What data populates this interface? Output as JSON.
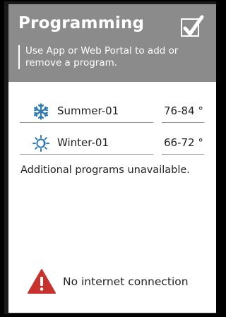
{
  "header": {
    "title": "Programming",
    "subtitle": "Use App or Web Portal to add or remove a program.",
    "checkbox_icon": "checkmark-icon",
    "background": "#8b8b8b"
  },
  "programs": [
    {
      "icon": "snowflake-icon",
      "name": "Summer-01",
      "temp": "76-84 °",
      "icon_color": "#2b7ab5"
    },
    {
      "icon": "sun-moon-icon",
      "name": "Winter-01",
      "temp": "66-72 °",
      "icon_color": "#2b7ab5"
    }
  ],
  "unavailable_text": "Additional programs unavailable.",
  "status": {
    "icon": "warning-icon",
    "message": "No internet connection",
    "icon_color": "#c8312e"
  }
}
